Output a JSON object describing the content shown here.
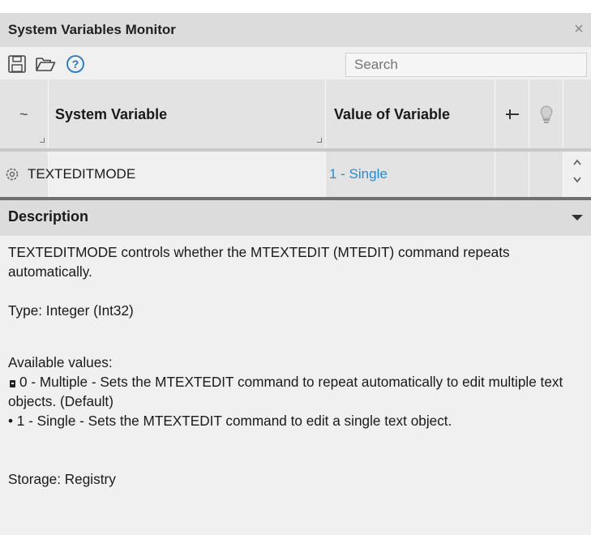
{
  "window": {
    "title": "System Variables Monitor",
    "close_label": "×"
  },
  "toolbar": {
    "icons": [
      "save-icon",
      "open-folder-icon",
      "help-icon"
    ],
    "help_glyph": "?",
    "search_placeholder": "Search"
  },
  "grid": {
    "columns": {
      "flag": "~",
      "name": "System Variable",
      "value": "Value of Variable",
      "pin_icon": "pin-icon",
      "bulb_icon": "lightbulb-icon"
    },
    "rows": [
      {
        "icon": "gear-icon",
        "name": "TEXTEDITMODE",
        "value": "1 - Single"
      }
    ],
    "value_color": "#1e8fd6"
  },
  "description": {
    "header": "Description",
    "summary": "TEXTEDITMODE controls whether the MTEXTEDIT (MTEDIT) command repeats automatically.",
    "type": "Type: Integer (Int32)",
    "values_heading": "Available values:",
    "value_0": "0 - Multiple - Sets the MTEXTEDIT command to repeat automatically to edit multiple text objects. (Default)",
    "value_1": "• 1 - Single - Sets the MTEXTEDIT command to edit a single text object.",
    "storage": "Storage: Registry"
  }
}
